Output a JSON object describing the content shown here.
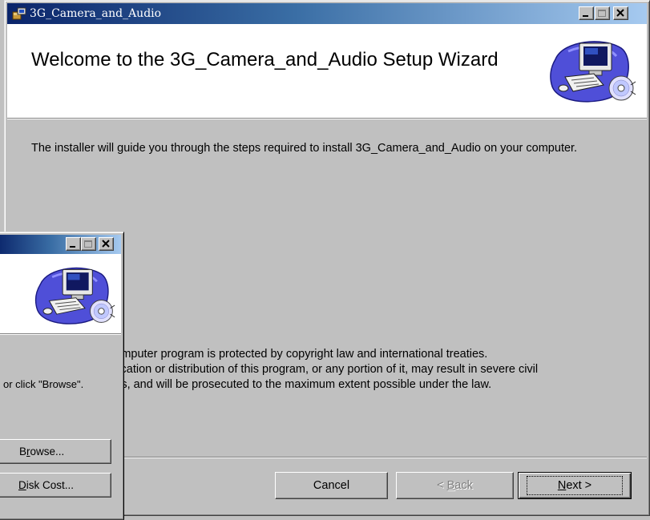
{
  "main_window": {
    "title": "3G_Camera_and_Audio",
    "header_title": "Welcome to the 3G_Camera_and_Audio Setup Wizard",
    "intro": "The installer will guide you through the steps required to install 3G_Camera_and_Audio on your computer.",
    "copyright_lines": [
      "computer program is protected by copyright law and international treaties.",
      "plication or distribution of this program, or any portion of it, may result in severe civil",
      "ties, and will be prosecuted to the maximum extent possible under the law."
    ],
    "buttons": {
      "cancel": "Cancel",
      "back_prefix": "< ",
      "back_accel": "B",
      "back_rest": "ack",
      "next_accel": "N",
      "next_rest": "ext >"
    }
  },
  "back_window": {
    "text": "or click \"Browse\".",
    "browse_accel": "r",
    "browse_pre": "B",
    "browse_post": "owse...",
    "diskcost_accel": "D",
    "diskcost_rest": "isk Cost..."
  },
  "colors": {
    "title_bar_start": "#0a246a",
    "title_bar_end": "#a6caf0",
    "dialog_face": "#c0c0c0",
    "header_bg": "#ffffff"
  },
  "icons": [
    "installer-app-icon",
    "minimize-icon",
    "maximize-icon",
    "close-icon",
    "computer-cd-icon"
  ]
}
